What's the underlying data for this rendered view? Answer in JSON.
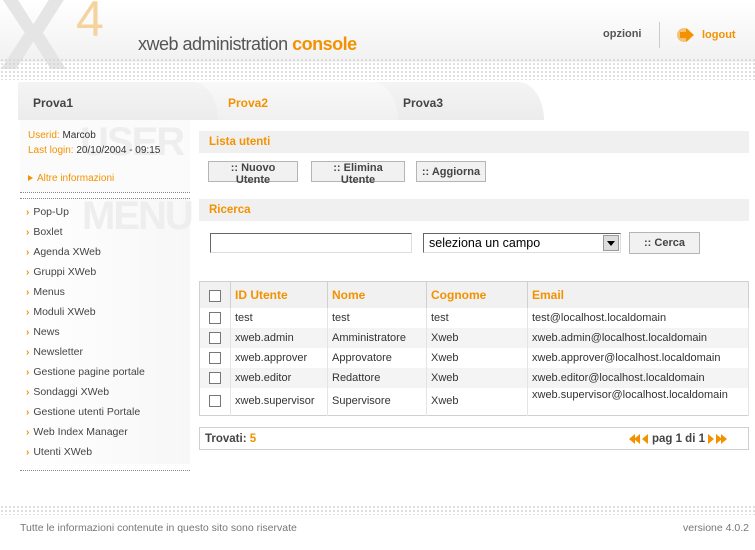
{
  "app": {
    "logo_x": "X",
    "logo_4": "4",
    "title_main": "xweb administration ",
    "title_accent": "console",
    "opzioni": "opzioni",
    "logout": "logout"
  },
  "tabs": [
    {
      "label": "Prova1"
    },
    {
      "label": "Prova2",
      "active": true
    },
    {
      "label": "Prova3"
    }
  ],
  "sidebar": {
    "watermark_user": "USER",
    "watermark_menu": "MENU",
    "userid_label": "Userid: ",
    "userid_value": "Marcob",
    "lastlogin_label": "Last login: ",
    "lastlogin_value": "20/10/2004  -  09:15",
    "more_info": "Altre informazioni",
    "menu": [
      "Pop-Up",
      "Boxlet",
      "Agenda XWeb",
      "Gruppi XWeb",
      "Menus",
      "Moduli XWeb",
      "News",
      "Newsletter",
      "Gestione pagine portale",
      "Sondaggi XWeb",
      "Gestione utenti Portale",
      "Web Index Manager",
      "Utenti XWeb"
    ]
  },
  "main": {
    "list_title": "Lista utenti",
    "buttons": {
      "new": ":: Nuovo Utente",
      "delete": ":: Elimina Utente",
      "refresh": ":: Aggiorna"
    },
    "search_title": "Ricerca",
    "search_value": "",
    "select_value": "seleziona un campo",
    "search_button": ":: Cerca",
    "table": {
      "headers": [
        "ID Utente",
        "Nome",
        "Cognome",
        "Email"
      ],
      "rows": [
        [
          "test",
          "test",
          "test",
          "test@localhost.localdomain"
        ],
        [
          "xweb.admin",
          "Amministratore",
          "Xweb",
          "xweb.admin@localhost.localdomain"
        ],
        [
          "xweb.approver",
          "Approvatore",
          "Xweb",
          "xweb.approver@localhost.localdomain"
        ],
        [
          "xweb.editor",
          "Redattore",
          "Xweb",
          "xweb.editor@localhost.localdomain"
        ],
        [
          "xweb.supervisor",
          "Supervisore",
          "Xweb",
          "xweb.supervisor@localhost.localdomain"
        ]
      ]
    },
    "found_label": "Trovati: ",
    "found_count": "5",
    "page_text": "pag 1 di 1"
  },
  "footer": {
    "left": "Tutte le informazioni contenute in questo sito sono riservate",
    "right": "versione 4.0.2"
  },
  "colors": {
    "accent": "#f39200",
    "text": "#333333",
    "section_bg": "#f0f0f0"
  },
  "icons": [
    "logout-arrow-icon",
    "orange-arrow-icon",
    "first-page-icon",
    "prev-page-icon",
    "next-page-icon",
    "last-page-icon",
    "dropdown-arrow-icon"
  ]
}
